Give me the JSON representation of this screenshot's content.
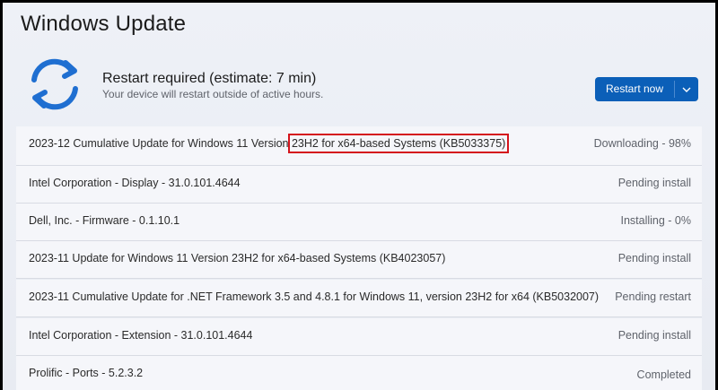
{
  "header": {
    "title": "Windows Update"
  },
  "status": {
    "title": "Restart required (estimate: 7 min)",
    "subtitle": "Your device will restart outside of active hours."
  },
  "restart_button": {
    "label": "Restart now"
  },
  "updates": [
    {
      "name_prefix": "2023-12 Cumulative Update for Windows 11 Version ",
      "name_highlight": "23H2 for x64-based Systems (KB5033375)",
      "status": "Downloading - 98%"
    },
    {
      "name": "Intel Corporation - Display - 31.0.101.4644",
      "status": "Pending install"
    },
    {
      "name": "Dell, Inc. - Firmware - 0.1.10.1",
      "status": "Installing - 0%"
    },
    {
      "name": "2023-11 Update for Windows 11 Version 23H2 for x64-based Systems (KB4023057)",
      "status": "Pending install"
    },
    {
      "name": "2023-11 Cumulative Update for .NET Framework 3.5 and 4.8.1 for Windows 11, version 23H2 for x64 (KB5032007)",
      "status": "Pending restart"
    },
    {
      "name": "Intel Corporation - Extension - 31.0.101.4644",
      "status": "Pending install"
    },
    {
      "name": "Prolific - Ports - 5.2.3.2",
      "status": "Completed"
    }
  ],
  "icons": {
    "status": "sync-icon",
    "dropdown": "chevron-down-icon"
  },
  "colors": {
    "accent": "#0b5fb8",
    "highlight_box": "#d4141c",
    "sync_icon": "#1f6fd1"
  }
}
